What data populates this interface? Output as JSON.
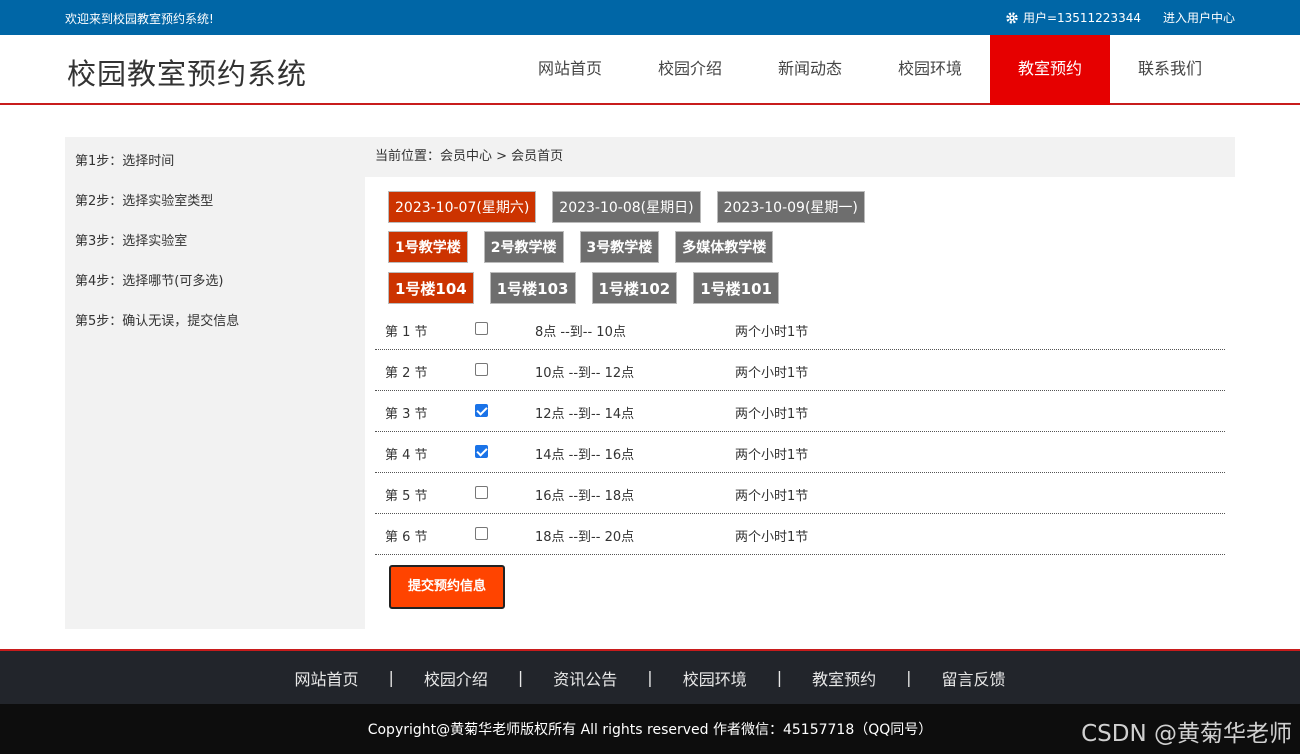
{
  "topbar": {
    "welcome": "欢迎来到校园教室预约系统!",
    "user_label": "用户=13511223344",
    "user_center": "进入用户中心"
  },
  "header": {
    "logo": "校园教室预约系统",
    "nav": [
      {
        "label": "网站首页"
      },
      {
        "label": "校园介绍"
      },
      {
        "label": "新闻动态"
      },
      {
        "label": "校园环境"
      },
      {
        "label": "教室预约",
        "active": true
      },
      {
        "label": "联系我们"
      }
    ]
  },
  "sidebar": {
    "steps": [
      "第1步：选择时间",
      "第2步：选择实验室类型",
      "第3步：选择实验室",
      "第4步：选择哪节(可多选)",
      "第5步：确认无误，提交信息"
    ]
  },
  "main": {
    "breadcrumb": "当前位置：会员中心 > 会员首页",
    "dates": [
      {
        "label": "2023-10-07(星期六)",
        "active": true
      },
      {
        "label": "2023-10-08(星期日)",
        "active": false
      },
      {
        "label": "2023-10-09(星期一)",
        "active": false
      }
    ],
    "buildings": [
      {
        "label": "1号教学楼",
        "active": true
      },
      {
        "label": "2号教学楼",
        "active": false
      },
      {
        "label": "3号教学楼",
        "active": false
      },
      {
        "label": "多媒体教学楼",
        "active": false
      }
    ],
    "rooms": [
      {
        "label": "1号楼104",
        "active": true
      },
      {
        "label": "1号楼103",
        "active": false
      },
      {
        "label": "1号楼102",
        "active": false
      },
      {
        "label": "1号楼101",
        "active": false
      }
    ],
    "slots": [
      {
        "name": "第 1 节",
        "checked": false,
        "time": "8点 --到-- 10点",
        "duration": "两个小时1节"
      },
      {
        "name": "第 2 节",
        "checked": false,
        "time": "10点 --到-- 12点",
        "duration": "两个小时1节"
      },
      {
        "name": "第 3 节",
        "checked": true,
        "time": "12点 --到-- 14点",
        "duration": "两个小时1节"
      },
      {
        "name": "第 4 节",
        "checked": true,
        "time": "14点 --到-- 16点",
        "duration": "两个小时1节"
      },
      {
        "name": "第 5 节",
        "checked": false,
        "time": "16点 --到-- 18点",
        "duration": "两个小时1节"
      },
      {
        "name": "第 6 节",
        "checked": false,
        "time": "18点 --到-- 20点",
        "duration": "两个小时1节"
      }
    ],
    "submit_label": "提交预约信息"
  },
  "footer": {
    "links": [
      "网站首页",
      "校园介绍",
      "资讯公告",
      "校园环境",
      "教室预约",
      "留言反馈"
    ],
    "separator": "|",
    "copyright": "Copyright@黄菊华老师版权所有 All rights reserved 作者微信：45157718（QQ同号）"
  },
  "watermark": "CSDN @黄菊华老师",
  "colors": {
    "topbar": "#0066a6",
    "nav_active": "#e60000",
    "chip_active": "#cc3300",
    "chip": "#6e6e6e",
    "submit": "#ff4400"
  }
}
